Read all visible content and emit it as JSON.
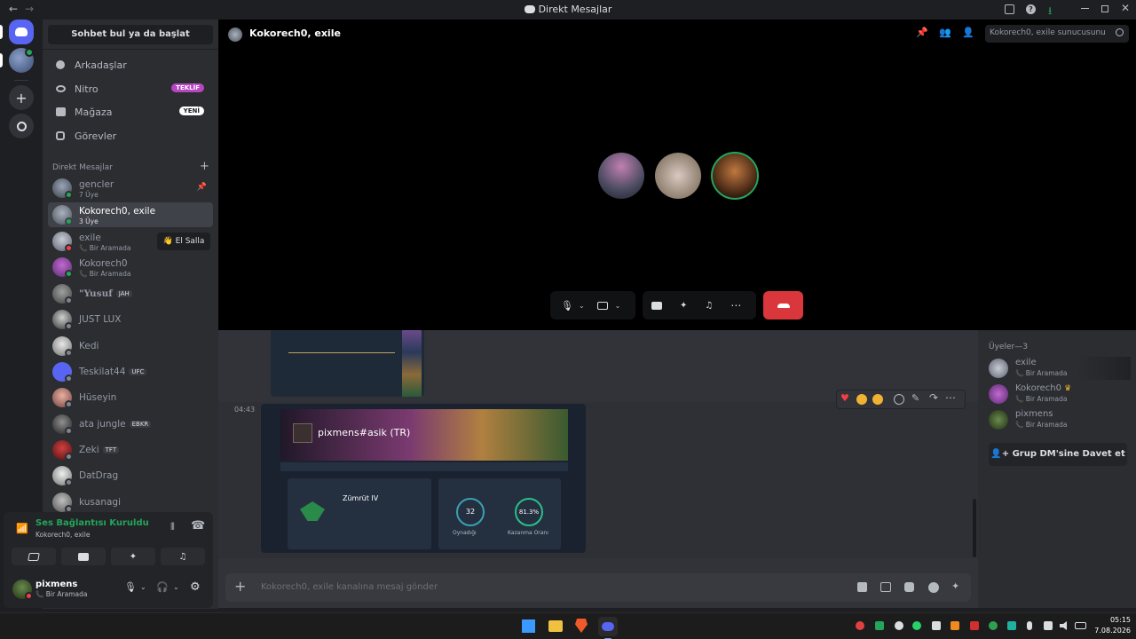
{
  "window": {
    "title": "Direkt Mesajlar"
  },
  "sidebar": {
    "search_label": "Sohbet bul ya da başlat",
    "nav": [
      {
        "label": "Arkadaşlar"
      },
      {
        "label": "Nitro",
        "badge": "TEKLİF"
      },
      {
        "label": "Mağaza",
        "badge": "YENİ"
      },
      {
        "label": "Görevler"
      }
    ],
    "dm_header": "Direkt Mesajlar",
    "dms": [
      {
        "name": "gencler",
        "sub": "7 Üye"
      },
      {
        "name": "Kokorech0, exile",
        "sub": "3 Üye"
      },
      {
        "name": "exile",
        "sub": "Bir Aramada"
      },
      {
        "name": "Kokorech0",
        "sub": "Bir Aramada"
      },
      {
        "name": "\"Yusuf",
        "tag": "JAH"
      },
      {
        "name": "JUST LUX"
      },
      {
        "name": "Kedi"
      },
      {
        "name": "Teskilat44",
        "tag": "UFC"
      },
      {
        "name": "Hüseyin"
      },
      {
        "name": "ata jungle",
        "tag": "EBKR"
      },
      {
        "name": "Zeki",
        "tag": "TFT"
      },
      {
        "name": "DatDrag"
      },
      {
        "name": "kusanagi"
      }
    ],
    "wave_label": "El Salla"
  },
  "voice": {
    "status": "Ses Bağlantısı Kuruldu",
    "channel": "Kokorech0, exile"
  },
  "user": {
    "name": "pixmens",
    "status": "Bir Aramada"
  },
  "header": {
    "channel": "Kokorech0, exile",
    "search_placeholder": "Kokorech0, exile sunucusunu ara"
  },
  "message": {
    "time": "04:43",
    "profile_name": "pixmens#asik (TR)",
    "rank": "Zümrüt IV",
    "stat_games": "32",
    "stat_games_label": "Oynadığı",
    "stat_winrate": "81.3%",
    "stat_winrate_label": "Kazanma Oranı"
  },
  "composer": {
    "placeholder": "Kokorech0, exile kanalına mesaj gönder"
  },
  "members": {
    "header": "Üyeler—3",
    "list": [
      {
        "name": "exile",
        "sub": "Bir Aramada"
      },
      {
        "name": "Kokorech0",
        "sub": "Bir Aramada"
      },
      {
        "name": "pixmens",
        "sub": "Bir Aramada"
      }
    ],
    "invite_label": "Grup DM'sine Davet et"
  },
  "taskbar": {
    "time": "05:15",
    "date": "7.08.2026"
  },
  "colors": {
    "accent": "#5865f2",
    "hangup": "#da373c",
    "online": "#23a55a",
    "nitro": "#b845c1"
  }
}
